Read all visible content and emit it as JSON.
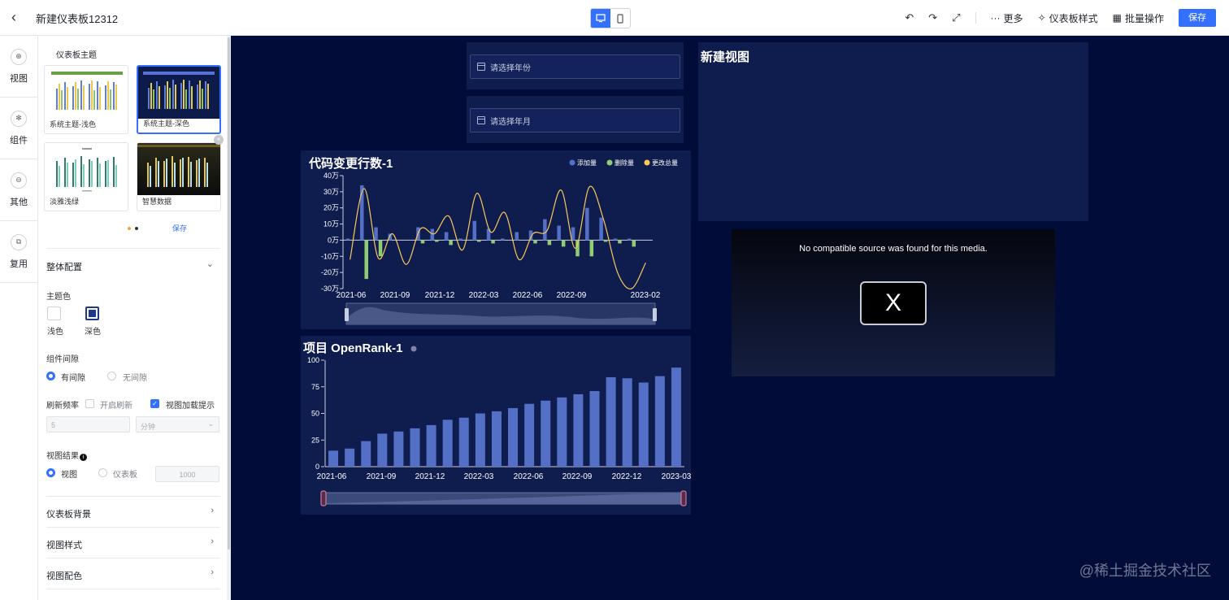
{
  "topbar": {
    "title": "新建仪表板12312",
    "more": "更多",
    "dashboard_style": "仪表板样式",
    "batch_ops": "批量操作",
    "save": "保存"
  },
  "rail": {
    "items": [
      "视图",
      "组件",
      "其他",
      "复用"
    ]
  },
  "panel": {
    "theme_section": "仪表板主题",
    "themes": [
      {
        "label": "系统主题-浅色"
      },
      {
        "label": "系统主题-深色",
        "selected": true
      },
      {
        "label": "淡雅浅绿"
      },
      {
        "label": "智慧数据"
      }
    ],
    "save_link": "保存",
    "overall": "整体配置",
    "theme_color": "主题色",
    "light": "浅色",
    "dark": "深色",
    "gap": "组件间隙",
    "gap_on": "有间隙",
    "gap_off": "无间隙",
    "refresh": "刷新频率",
    "refresh_enable": "开启刷新",
    "load_tip": "视图加载提示",
    "refresh_value": "5",
    "refresh_unit": "分钟",
    "result": "视图结果",
    "result_view": "视图",
    "result_dashboard": "仪表板",
    "result_value": "1000",
    "bg": "仪表板背景",
    "view_style": "视图样式",
    "view_color": "视图配色"
  },
  "canvas": {
    "filter_year": "请选择年份",
    "filter_month": "请选择年月",
    "new_view": "新建视图",
    "video_msg": "No compatible source was found for this media.",
    "video_x": "X",
    "watermark": "@稀土掘金技术社区"
  },
  "colors": {
    "accent": "#3370ff",
    "bg": "#020c38",
    "card": "#0f1d4e",
    "add": "#5470c6",
    "del": "#91cc75",
    "total": "#fac858"
  },
  "chart_data": [
    {
      "type": "bar",
      "title": "代码变更行数-1",
      "legend": [
        "添加量",
        "删除量",
        "更改总量"
      ],
      "legend_position": "top-right",
      "ylim": [
        -300000,
        400000
      ],
      "yticks": [
        "40万",
        "30万",
        "20万",
        "10万",
        "0万",
        "-10万",
        "-20万",
        "-30万"
      ],
      "xticks": [
        "2021-06",
        "2021-09",
        "2021-12",
        "2022-03",
        "2022-06",
        "2022-09",
        "2023-02"
      ],
      "categories": [
        "2021-05",
        "2021-06",
        "2021-07",
        "2021-08",
        "2021-09",
        "2021-10",
        "2021-11",
        "2021-12",
        "2022-01",
        "2022-02",
        "2022-03",
        "2022-04",
        "2022-05",
        "2022-06",
        "2022-07",
        "2022-08",
        "2022-09",
        "2022-10",
        "2022-11",
        "2022-12",
        "2023-01",
        "2023-02"
      ],
      "series": [
        {
          "name": "添加量",
          "values": [
            10000,
            340000,
            80000,
            40000,
            0,
            80000,
            70000,
            50000,
            10000,
            120000,
            70000,
            10000,
            50000,
            60000,
            130000,
            90000,
            80000,
            200000,
            140000,
            10000,
            10000,
            0
          ]
        },
        {
          "name": "删除量",
          "values": [
            0,
            -240000,
            -100000,
            0,
            0,
            -20000,
            -10000,
            -30000,
            0,
            -10000,
            -20000,
            0,
            0,
            -20000,
            -30000,
            -40000,
            -100000,
            -100000,
            -10000,
            -20000,
            -40000,
            0
          ]
        },
        {
          "name": "更改总量",
          "values": [
            -120000,
            320000,
            -110000,
            40000,
            -150000,
            70000,
            40000,
            150000,
            -60000,
            290000,
            50000,
            170000,
            -120000,
            40000,
            60000,
            310000,
            -50000,
            330000,
            130000,
            -200000,
            -300000,
            -140000
          ]
        }
      ]
    },
    {
      "type": "bar",
      "title": "项目 OpenRank-1",
      "ylim": [
        0,
        100
      ],
      "yticks": [
        "100",
        "75",
        "50",
        "25",
        "0"
      ],
      "xticks": [
        "2021-06",
        "2021-09",
        "2021-12",
        "2022-03",
        "2022-06",
        "2022-09",
        "2022-12",
        "2023-03"
      ],
      "categories": [
        "2021-04",
        "2021-05",
        "2021-06",
        "2021-07",
        "2021-08",
        "2021-09",
        "2021-10",
        "2021-11",
        "2021-12",
        "2022-01",
        "2022-02",
        "2022-03",
        "2022-04",
        "2022-05",
        "2022-06",
        "2022-07",
        "2022-08",
        "2022-09",
        "2022-10",
        "2022-11",
        "2022-12",
        "2023-01",
        "2023-02"
      ],
      "values": [
        15,
        17,
        24,
        31,
        33,
        36,
        39,
        44,
        46,
        50,
        52,
        55,
        59,
        62,
        65,
        68,
        71,
        84,
        83,
        79,
        85,
        93
      ]
    }
  ]
}
